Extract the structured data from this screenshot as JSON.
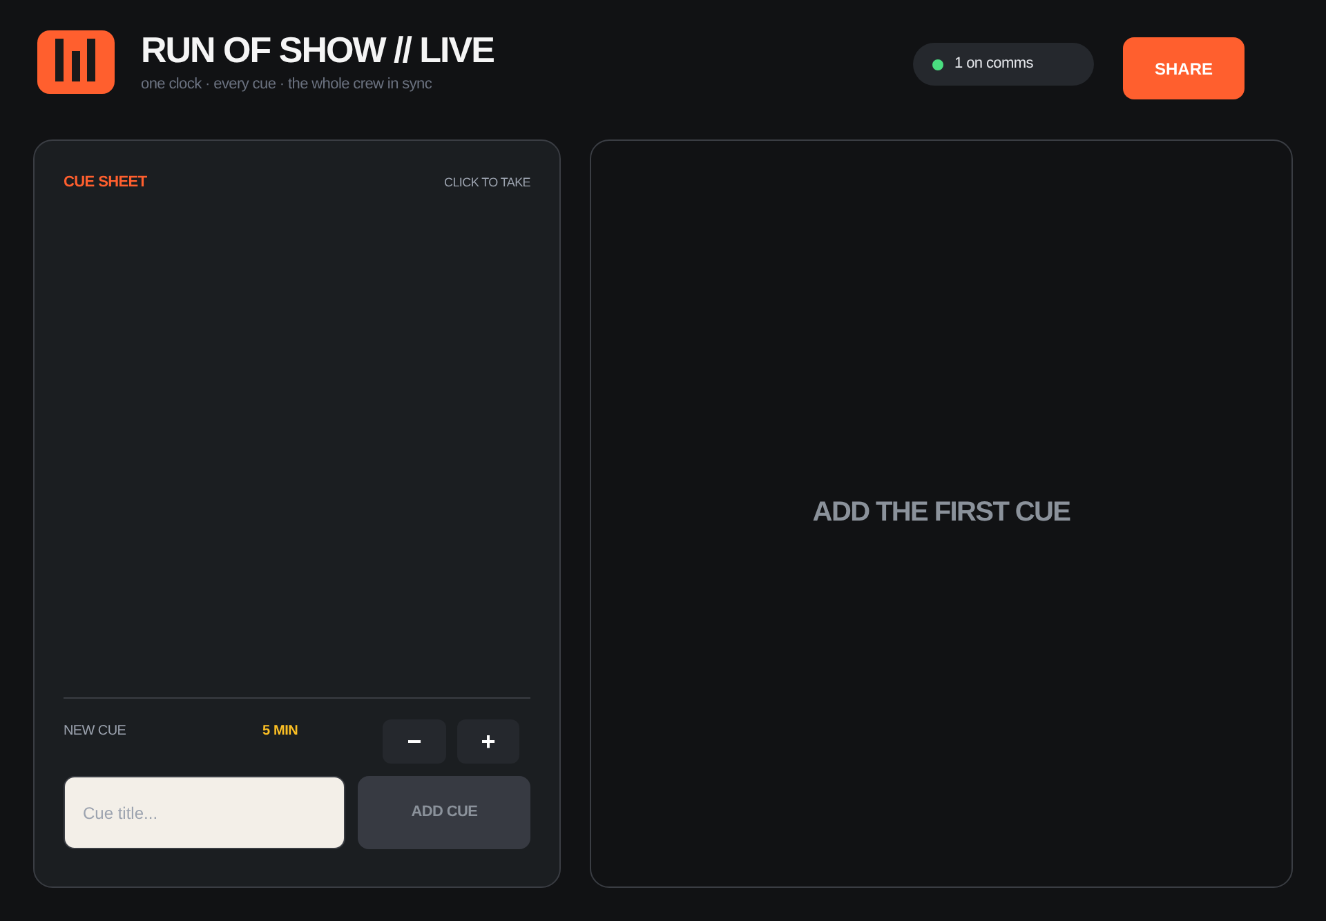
{
  "header": {
    "title": "RUN OF SHOW // LIVE",
    "subtitle": "one clock · every cue · the whole crew in sync",
    "presence": "1 on comms",
    "share_button": "SHARE"
  },
  "cue_sheet": {
    "title": "CUE SHEET",
    "hint": "CLICK TO TAKE",
    "new_cue": {
      "label": "NEW CUE",
      "duration": "5 MIN",
      "decrement": "−",
      "increment": "+",
      "title_field": {
        "placeholder": "Cue title..."
      },
      "add_button": {
        "label": "ADD CUE",
        "disabled": true
      }
    }
  },
  "stage": {
    "empty_message": "ADD THE FIRST CUE"
  }
}
